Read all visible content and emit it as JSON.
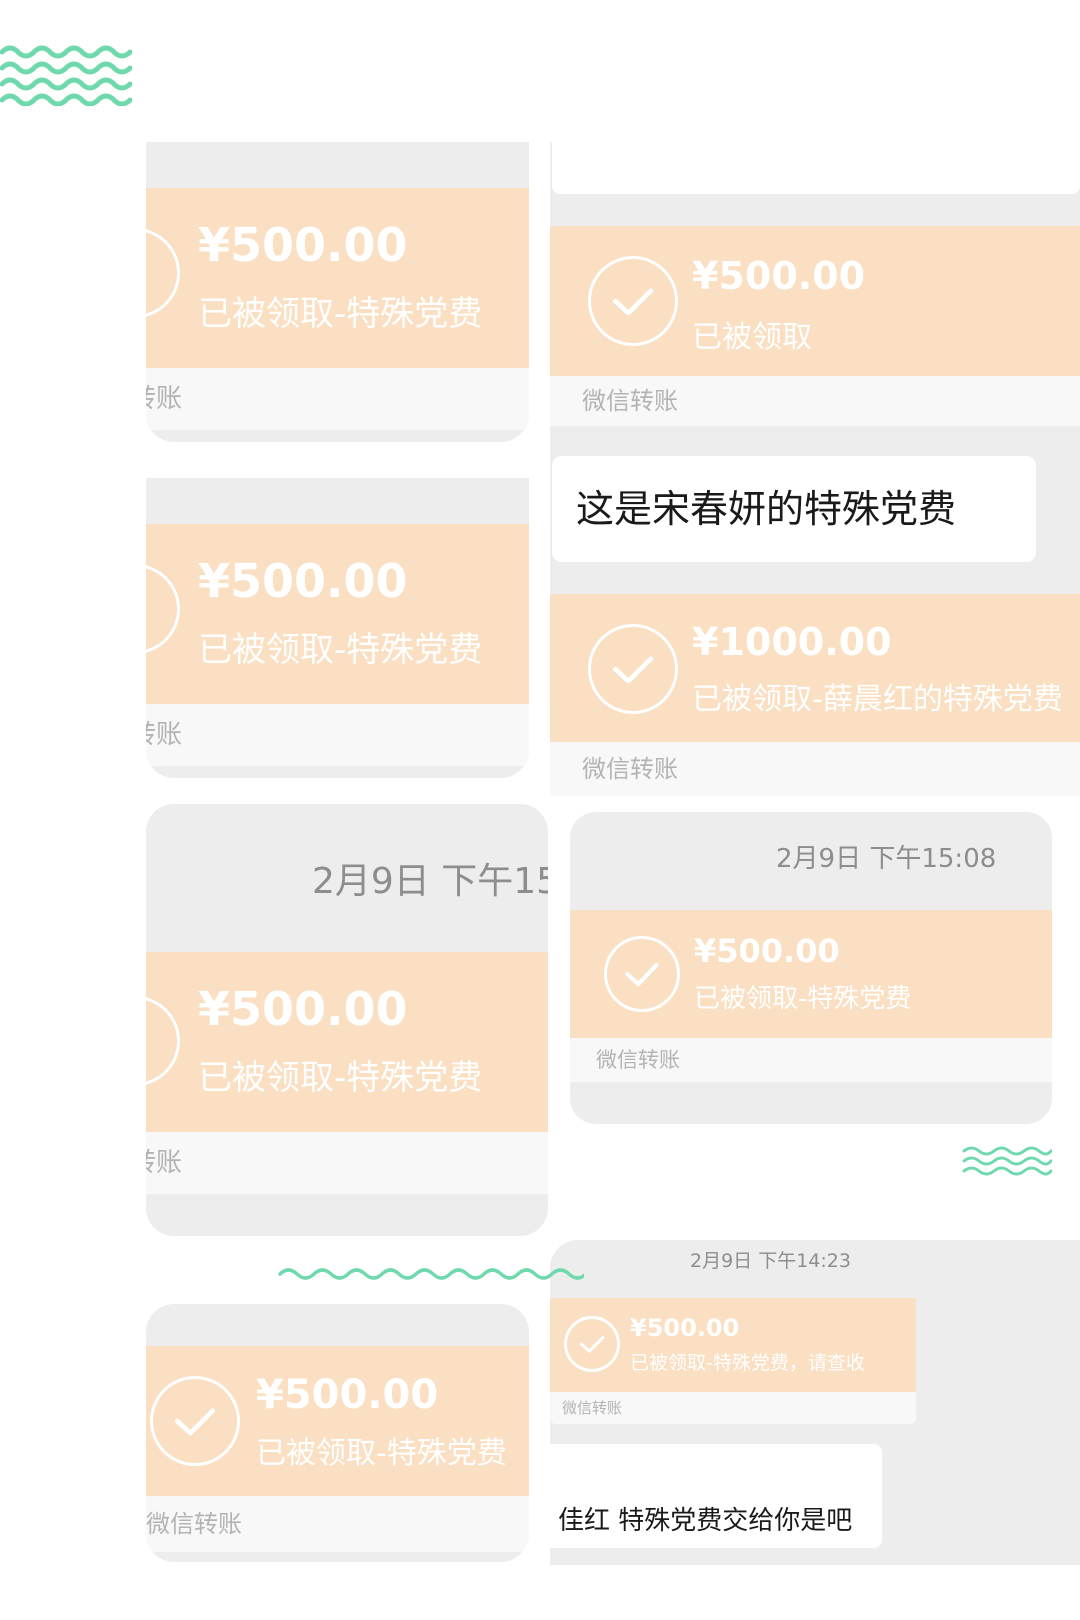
{
  "transfers": [
    {
      "amount": "¥500.00",
      "status": "已被领取-特殊党费",
      "footer": "转账"
    },
    {
      "amount": "¥500.00",
      "status": "已被领取",
      "footer": "微信转账"
    },
    {
      "amount": "¥500.00",
      "status": "已被领取-特殊党费",
      "footer": "转账"
    },
    {
      "amount": "¥1000.00",
      "status": "已被领取-薛晨红的特殊党费",
      "footer": "微信转账"
    },
    {
      "amount": "¥500.00",
      "status": "已被领取-特殊党费",
      "footer": "转账"
    },
    {
      "amount": "¥500.00",
      "status": "已被领取-特殊党费",
      "footer": "微信转账"
    },
    {
      "amount": "¥500.00",
      "status": "已被领取-特殊党费，请查收",
      "footer": "微信转账"
    },
    {
      "amount": "¥500.00",
      "status": "已被领取-特殊党费",
      "footer": "微信转账"
    }
  ],
  "messages": [
    "这是宋春妍的特殊党费",
    "佳红 特殊党费交给你是吧"
  ],
  "timestamps": [
    "2月9日 下午15",
    "2月9日 下午15:08",
    "2月9日 下午14:23"
  ],
  "colors": {
    "transfer_card": "#fadfc2",
    "chat_bg": "#ededed",
    "wave_accent": "#6fd9ad"
  },
  "icons": [
    "check-circle-icon",
    "wave-decoration-icon"
  ]
}
